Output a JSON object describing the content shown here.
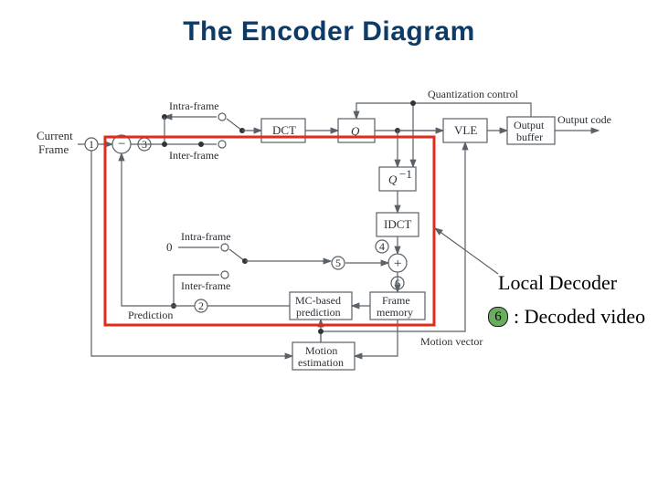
{
  "title": "The Encoder Diagram",
  "labels": {
    "current": "Current",
    "frame": "Frame",
    "intra_top": "Intra-frame",
    "inter_top": "Inter-frame",
    "intra_mid": "Intra-frame",
    "inter_mid": "Inter-frame",
    "prediction": "Prediction",
    "quant_control": "Quantization control",
    "output_code": "Output code",
    "motion_vector": "Motion vector",
    "zero": "0"
  },
  "blocks": {
    "dct": "DCT",
    "q": "Q",
    "qinv_top": "Q",
    "qinv_sup": "−1",
    "idct": "IDCT",
    "vle": "VLE",
    "outbuf1": "Output",
    "outbuf2": "buffer",
    "mcpred1": "MC-based",
    "mcpred2": "prediction",
    "framemem1": "Frame",
    "framemem2": "memory",
    "motion1": "Motion",
    "motion2": "estimation"
  },
  "nodes": {
    "n1": "1",
    "n2": "2",
    "n3": "3",
    "n4": "4",
    "n5": "5",
    "n6": "6"
  },
  "ops": {
    "minus": "−",
    "plus": "+"
  },
  "annotations": {
    "local_decoder": "Local Decoder",
    "decoded_badge": "6",
    "decoded_text": ": Decoded video"
  }
}
